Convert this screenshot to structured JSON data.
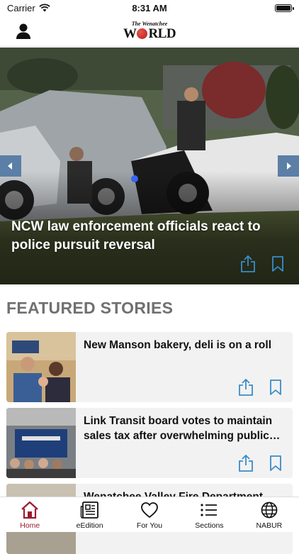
{
  "status_bar": {
    "carrier": "Carrier",
    "time": "8:31 AM",
    "battery_level": 1.0
  },
  "header": {
    "logo_top": "The Wenatchee",
    "logo_main_left": "W",
    "logo_main_right": "RLD"
  },
  "hero": {
    "title": "NCW law enforcement officials react to police pursuit reversal",
    "icons": [
      "chevron-left-icon",
      "chevron-right-icon",
      "share-icon",
      "bookmark-icon"
    ]
  },
  "featured": {
    "section_title": "FEATURED STORIES",
    "stories": [
      {
        "title": "New Manson bakery, deli is on a roll"
      },
      {
        "title": "Link Transit board votes to maintain sales tax after overwhelming public support"
      },
      {
        "title": "Wenatchee Valley Fire Department"
      }
    ]
  },
  "tabs": [
    {
      "label": "Home",
      "icon": "home-icon",
      "active": true
    },
    {
      "label": "eEdition",
      "icon": "newspaper-icon",
      "active": false
    },
    {
      "label": "For You",
      "icon": "heart-icon",
      "active": false
    },
    {
      "label": "Sections",
      "icon": "list-icon",
      "active": false
    },
    {
      "label": "NABUR",
      "icon": "globe-icon",
      "active": false
    }
  ],
  "colors": {
    "accent": "#3a8cc7",
    "active_tab": "#9b1b30",
    "arrow_bg": "#5b7fa6"
  }
}
